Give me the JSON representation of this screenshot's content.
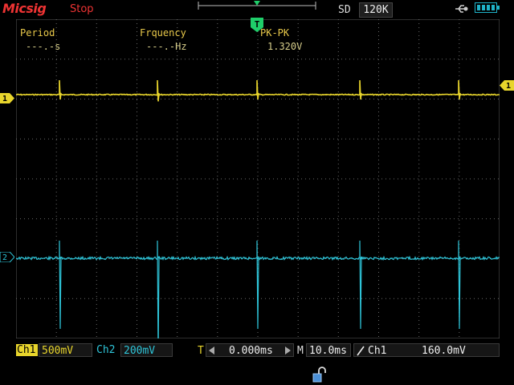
{
  "app": {
    "brand": "Micsig",
    "run_state": "Stop"
  },
  "status": {
    "storage": "SD",
    "memory_depth": "120K"
  },
  "measurements": [
    {
      "label": "Period",
      "value": "---.-s"
    },
    {
      "label": "Frquency",
      "value": "---.-Hz"
    },
    {
      "label": "PK-PK",
      "value": "1.320V"
    }
  ],
  "channels": {
    "ch1": {
      "tag": "Ch1",
      "scale": "500mV",
      "marker": "1",
      "color": "#e8d52c"
    },
    "ch2": {
      "tag": "Ch2",
      "scale": "200mV",
      "marker": "2",
      "color": "#2ec4d8"
    }
  },
  "timebase": {
    "trigger_label": "T",
    "offset": "0.000ms",
    "main_label": "M",
    "main": "10.0ms"
  },
  "trigger": {
    "source": "Ch1",
    "level": "160.0mV",
    "marker": "T"
  },
  "icons": [
    "usb-icon",
    "battery-icon",
    "lock-icon",
    "rising-edge-icon"
  ]
}
